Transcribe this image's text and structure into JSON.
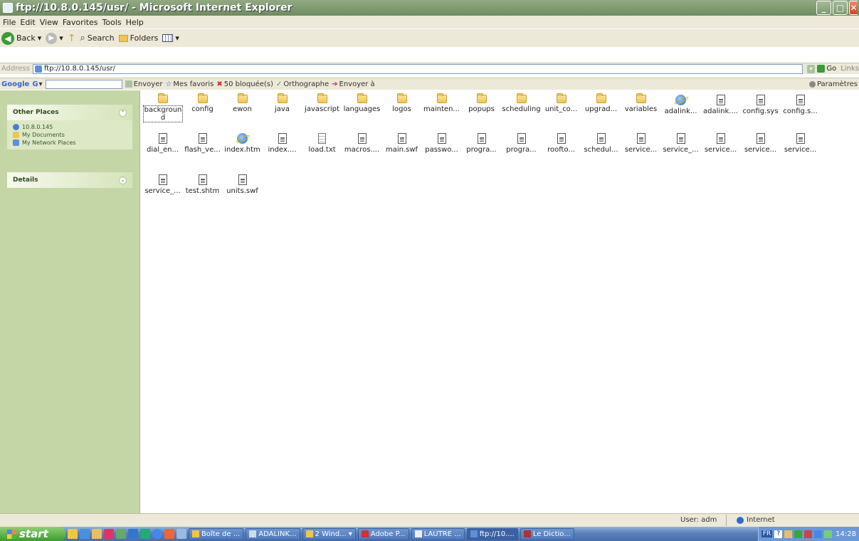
{
  "window": {
    "title": "ftp://10.8.0.145/usr/ - Microsoft Internet Explorer",
    "colors": {
      "title_green": "#7e9b6e",
      "sidebar_green": "#c5d6a6",
      "close_red": "#c8482c"
    }
  },
  "menu": [
    "File",
    "Edit",
    "View",
    "Favorites",
    "Tools",
    "Help"
  ],
  "toolbar": {
    "back": "Back",
    "search": "Search",
    "folders": "Folders"
  },
  "address": {
    "label": "Address",
    "value": "ftp://10.8.0.145/usr/",
    "go": "Go",
    "links": "Links"
  },
  "googlebar": {
    "label": "Google",
    "g": "G",
    "envoyer": "Envoyer",
    "mes_favoris": "Mes favoris",
    "bloquees": "50 bloquée(s)",
    "orthographe": "Orthographe",
    "envoyer_a": "Envoyer à",
    "parametres": "Paramètres"
  },
  "sidebar": {
    "other_places": {
      "title": "Other Places",
      "items": [
        "10.8.0.145",
        "My Documents",
        "My Network Places"
      ]
    },
    "details": {
      "title": "Details"
    }
  },
  "files": [
    {
      "name": "background",
      "type": "folder",
      "selected": true
    },
    {
      "name": "config",
      "type": "folder"
    },
    {
      "name": "ewon",
      "type": "folder"
    },
    {
      "name": "java",
      "type": "folder"
    },
    {
      "name": "javascript",
      "type": "folder"
    },
    {
      "name": "languages",
      "type": "folder"
    },
    {
      "name": "logos",
      "type": "folder"
    },
    {
      "name": "mainten...",
      "type": "folder"
    },
    {
      "name": "popups",
      "type": "folder"
    },
    {
      "name": "scheduling",
      "type": "folder"
    },
    {
      "name": "unit_co...",
      "type": "folder"
    },
    {
      "name": "upgrad...",
      "type": "folder"
    },
    {
      "name": "variables",
      "type": "folder"
    },
    {
      "name": "adalink...",
      "type": "ie"
    },
    {
      "name": "adalink....",
      "type": "doc"
    },
    {
      "name": "config.sys",
      "type": "doc"
    },
    {
      "name": "config.s...",
      "type": "doc"
    },
    {
      "name": "dial_en...",
      "type": "doc"
    },
    {
      "name": "flash_ve...",
      "type": "doc"
    },
    {
      "name": "index.htm",
      "type": "ie"
    },
    {
      "name": "index....",
      "type": "doc"
    },
    {
      "name": "load.txt",
      "type": "txt"
    },
    {
      "name": "macros....",
      "type": "doc"
    },
    {
      "name": "main.swf",
      "type": "doc"
    },
    {
      "name": "passwo...",
      "type": "doc"
    },
    {
      "name": "progra...",
      "type": "doc"
    },
    {
      "name": "progra...",
      "type": "doc"
    },
    {
      "name": "roofto...",
      "type": "doc"
    },
    {
      "name": "schedul...",
      "type": "doc"
    },
    {
      "name": "service...",
      "type": "doc"
    },
    {
      "name": "service_...",
      "type": "doc"
    },
    {
      "name": "service...",
      "type": "doc"
    },
    {
      "name": "service...",
      "type": "doc"
    },
    {
      "name": "service...",
      "type": "doc"
    },
    {
      "name": "service_...",
      "type": "doc"
    },
    {
      "name": "test.shtm",
      "type": "doc"
    },
    {
      "name": "units.swf",
      "type": "doc"
    }
  ],
  "status": {
    "user": "User: adm",
    "zone": "Internet"
  },
  "taskbar": {
    "start": "start",
    "tasks": [
      "Boîte de ...",
      "ADALINK...",
      "2 Wind...",
      "Adobe P...",
      "LAUTRE ...",
      "ftp://10....",
      "Le Dictio..."
    ],
    "lang": "FR",
    "clock": "14:28"
  }
}
